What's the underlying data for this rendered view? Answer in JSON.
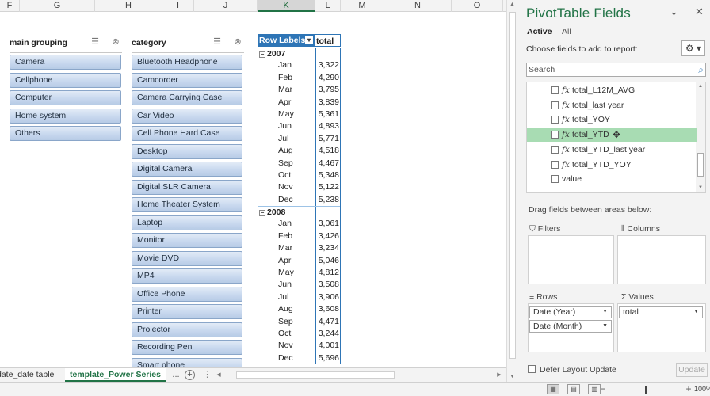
{
  "sheet": {
    "columns": [
      {
        "label": "F",
        "selected": false
      },
      {
        "label": "G",
        "selected": false
      },
      {
        "label": "H",
        "selected": false
      },
      {
        "label": "I",
        "selected": false
      },
      {
        "label": "J",
        "selected": false
      },
      {
        "label": "K",
        "selected": true
      },
      {
        "label": "L",
        "selected": false
      },
      {
        "label": "M",
        "selected": false
      },
      {
        "label": "N",
        "selected": false
      },
      {
        "label": "O",
        "selected": false
      }
    ]
  },
  "slicer_main": {
    "title": "main grouping",
    "items": [
      "Camera",
      "Cellphone",
      "Computer",
      "Home system",
      "Others"
    ]
  },
  "slicer_category": {
    "title": "category",
    "items": [
      "Bluetooth Headphone",
      "Camcorder",
      "Camera Carrying Case",
      "Car Video",
      "Cell Phone Hard Case",
      "Desktop",
      "Digital Camera",
      "Digital SLR Camera",
      "Home Theater System",
      "Laptop",
      "Monitor",
      "Movie DVD",
      "MP4",
      "Office Phone",
      "Printer",
      "Projector",
      "Recording Pen",
      "Smart phone"
    ]
  },
  "icons": {
    "multiselect": "multi-select-icon",
    "clear_filter": "clear-filter-icon"
  },
  "pivot": {
    "row_labels_header": "Row Labels",
    "value_header": "total",
    "rows": [
      {
        "type": "year",
        "label": "2007",
        "value": ""
      },
      {
        "type": "month",
        "label": "Jan",
        "value": "3,322"
      },
      {
        "type": "month",
        "label": "Feb",
        "value": "4,290"
      },
      {
        "type": "month",
        "label": "Mar",
        "value": "3,795"
      },
      {
        "type": "month",
        "label": "Apr",
        "value": "3,839"
      },
      {
        "type": "month",
        "label": "May",
        "value": "5,361"
      },
      {
        "type": "month",
        "label": "Jun",
        "value": "4,893"
      },
      {
        "type": "month",
        "label": "Jul",
        "value": "5,771"
      },
      {
        "type": "month",
        "label": "Aug",
        "value": "4,518"
      },
      {
        "type": "month",
        "label": "Sep",
        "value": "4,467"
      },
      {
        "type": "month",
        "label": "Oct",
        "value": "5,348"
      },
      {
        "type": "month",
        "label": "Nov",
        "value": "5,122"
      },
      {
        "type": "month",
        "label": "Dec",
        "value": "5,238"
      },
      {
        "type": "year",
        "label": "2008",
        "value": ""
      },
      {
        "type": "month",
        "label": "Jan",
        "value": "3,061"
      },
      {
        "type": "month",
        "label": "Feb",
        "value": "3,426"
      },
      {
        "type": "month",
        "label": "Mar",
        "value": "3,234"
      },
      {
        "type": "month",
        "label": "Apr",
        "value": "5,046"
      },
      {
        "type": "month",
        "label": "May",
        "value": "4,812"
      },
      {
        "type": "month",
        "label": "Jun",
        "value": "3,508"
      },
      {
        "type": "month",
        "label": "Jul",
        "value": "3,906"
      },
      {
        "type": "month",
        "label": "Aug",
        "value": "3,608"
      },
      {
        "type": "month",
        "label": "Sep",
        "value": "4,471"
      },
      {
        "type": "month",
        "label": "Oct",
        "value": "3,244"
      },
      {
        "type": "month",
        "label": "Nov",
        "value": "4,001"
      },
      {
        "type": "month",
        "label": "Dec",
        "value": "5,696"
      }
    ]
  },
  "tabs": {
    "first": "date_date table",
    "active": "template_Power Series",
    "ellipsis": "...",
    "add": "+",
    "dots": "⋮"
  },
  "status": {
    "zoom_minus": "−",
    "zoom_plus": "+",
    "zoom_pct": "100%",
    "zoom_level_percent": 100
  },
  "pane": {
    "title": "PivotTable Fields",
    "tab_active": "Active",
    "tab_all": "All",
    "choose_label": "Choose fields to add to report:",
    "search_placeholder": "Search",
    "fields": [
      {
        "name": "total_L12M_AVG",
        "fx": true,
        "highlight": false
      },
      {
        "name": "total_last year",
        "fx": true,
        "highlight": false
      },
      {
        "name": "total_YOY",
        "fx": true,
        "highlight": false
      },
      {
        "name": "total_YTD",
        "fx": true,
        "highlight": true
      },
      {
        "name": "total_YTD_last year",
        "fx": true,
        "highlight": false
      },
      {
        "name": "total_YTD_YOY",
        "fx": true,
        "highlight": false
      },
      {
        "name": "value",
        "fx": false,
        "highlight": false
      }
    ],
    "drag_label": "Drag fields between areas below:",
    "areas": {
      "filters": "Filters",
      "columns": "Columns",
      "rows": "Rows",
      "values": "Values",
      "rows_items": [
        "Date (Year)",
        "Date (Month)"
      ],
      "values_items": [
        "total"
      ]
    },
    "defer_label": "Defer Layout Update",
    "update_label": "Update"
  }
}
